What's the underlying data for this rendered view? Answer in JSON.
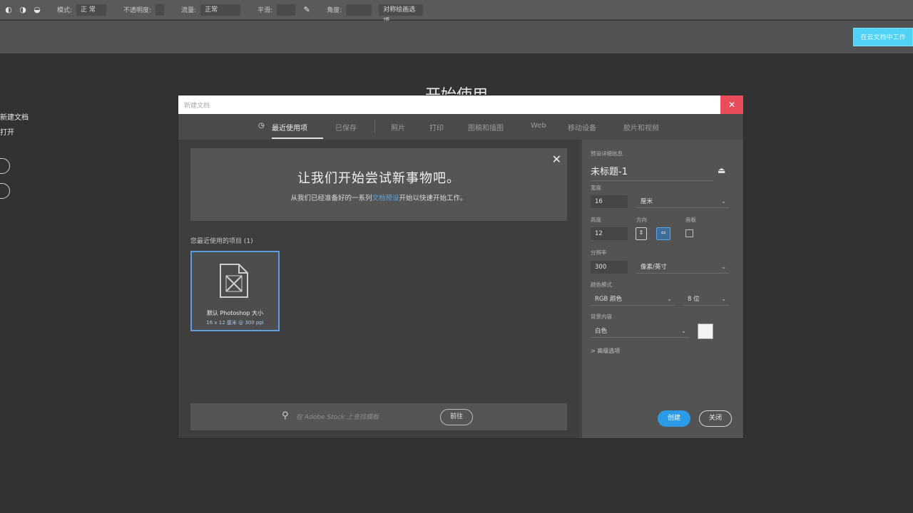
{
  "optbar": {
    "icons": [
      "tool-icon",
      "brush-icon",
      "airbrush-icon"
    ],
    "size_label": "模式:",
    "size_value": "正 常",
    "opacity_label": "不透明度:",
    "mode_label": "流量:",
    "mode_value": "正常",
    "flow_label": "平滑:",
    "smooth_label": "角度:",
    "pressure_label": "对称绘画选项"
  },
  "appbar": {
    "cloud_button": "在云文档中工作"
  },
  "home": {
    "title": "开始使用",
    "items": [
      "新建文档",
      "打开"
    ]
  },
  "dialog": {
    "title": "新建文档",
    "close_glyph": "✕",
    "tabs": [
      {
        "label": "最近使用项",
        "active": true
      },
      {
        "label": "已保存",
        "active": false
      },
      {
        "label": "照片",
        "active": false
      },
      {
        "label": "打印",
        "active": false
      },
      {
        "label": "图稿和插图",
        "active": false
      },
      {
        "label": "Web",
        "active": false
      },
      {
        "label": "移动设备",
        "active": false
      },
      {
        "label": "胶片和视频",
        "active": false
      }
    ],
    "banner": {
      "close_glyph": "✕",
      "headline": "让我们开始尝试新事物吧。",
      "sub_before": "从我们已经准备好的一系列",
      "sub_link": "文档预设",
      "sub_after": "开始以快速开始工作。"
    },
    "recent": {
      "label": "您最近使用的项目 (1)",
      "card_title": "默认 Photoshop 大小",
      "card_sub": "16 x 12 厘米 @ 300 ppi"
    },
    "search": {
      "placeholder": "在 Adobe Stock 上查找模板",
      "button": "前往"
    },
    "details": {
      "section_label": "预设详细信息",
      "preset_name": "未标题-1",
      "width_label": "宽度",
      "width_value": "16",
      "width_unit": "厘米",
      "height_label": "高度",
      "height_value": "12",
      "orientation_label": "方向",
      "artboard_label": "画板",
      "resolution_label": "分辨率",
      "resolution_value": "300",
      "resolution_unit": "像素/英寸",
      "colormode_label": "颜色模式",
      "colormode_value": "RGB 颜色",
      "bitdepth_value": "8 位",
      "background_label": "背景内容",
      "background_value": "白色",
      "advanced_label": "> 高级选项",
      "create_button": "创建",
      "close_button": "关闭"
    }
  }
}
